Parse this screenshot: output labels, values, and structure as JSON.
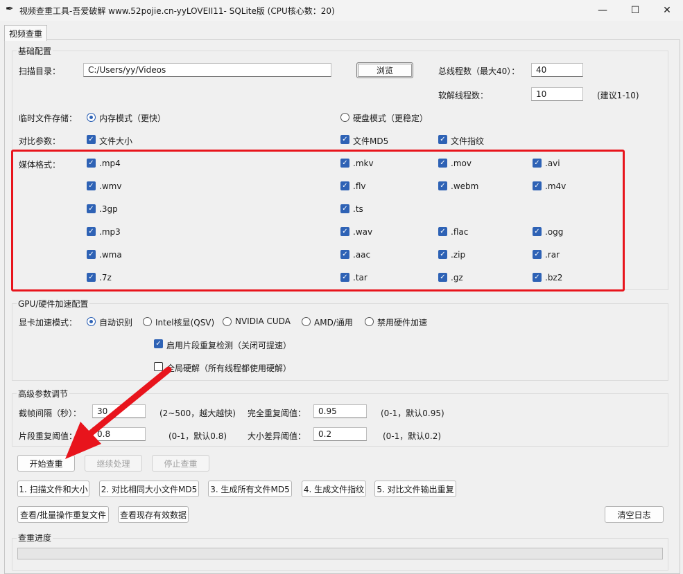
{
  "window": {
    "title": "视频查重工具-吾爱破解 www.52pojie.cn-yyLOVEII11- SQLite版 (CPU核心数：20)",
    "controls": [
      "—",
      "☐",
      "✕"
    ]
  },
  "tab": "视频查重",
  "basic": {
    "title": "基础配置",
    "scan_label": "扫描目录：",
    "scan_value": "C:/Users/yy/Videos",
    "browse": "浏览",
    "threads_label": "总线程数（最大40）：",
    "threads_value": "40",
    "soft_label": "软解线程数：",
    "soft_value": "10",
    "soft_hint": "(建议1-10)",
    "temp_label": "临时文件存储：",
    "temp_memory": "内存模式（更快）",
    "temp_disk": "硬盘模式（更稳定）",
    "compare_label": "对比参数：",
    "cmp_size": "文件大小",
    "cmp_md5": "文件MD5",
    "cmp_fp": "文件指纹",
    "media_label": "媒体格式：",
    "formats": [
      [
        ".mp4",
        ".mkv",
        ".mov",
        ".avi"
      ],
      [
        ".wmv",
        ".flv",
        ".webm",
        ".m4v"
      ],
      [
        ".3gp",
        ".ts",
        "",
        ""
      ],
      [
        ".mp3",
        ".wav",
        ".flac",
        ".ogg"
      ],
      [
        ".wma",
        ".aac",
        ".zip",
        ".rar"
      ],
      [
        ".7z",
        ".tar",
        ".gz",
        ".bz2"
      ]
    ]
  },
  "gpu": {
    "title": "GPU/硬件加速配置",
    "mode_label": "显卡加速模式：",
    "modes": [
      "自动识别",
      "Intel核显(QSV)",
      "NVIDIA CUDA",
      "AMD/通用",
      "禁用硬件加速"
    ],
    "segment": "启用片段重复检测（关闭可提速）",
    "global_hw": "全局硬解（所有线程都使用硬解）"
  },
  "advanced": {
    "title": "高级参数调节",
    "frame_label": "截帧间隔（秒）：",
    "frame_value": "30",
    "frame_hint": "(2~500，越大越快)",
    "full_label": "完全重复阈值：",
    "full_value": "0.95",
    "full_hint": "(0-1，默认0.95)",
    "seg_label": "片段重复阈值：",
    "seg_value": "0.8",
    "seg_hint": "(0-1，默认0.8)",
    "size_label": "大小差异阈值：",
    "size_value": "0.2",
    "size_hint": "(0-1，默认0.2)"
  },
  "actions": {
    "start": "开始查重",
    "continue": "继续处理",
    "stop": "停止查重",
    "step1": "1. 扫描文件和大小",
    "step2": "2. 对比相同大小文件MD5",
    "step3": "3. 生成所有文件MD5",
    "step4": "4. 生成文件指纹",
    "step5": "5. 对比文件输出重复",
    "view_dup": "查看/批量操作重复文件",
    "view_valid": "查看现存有效数据",
    "clear_log": "清空日志"
  },
  "progress": {
    "title": "查重进度",
    "value": 0
  },
  "colors": {
    "highlight": "#e8141c",
    "arrow": "#e8141c",
    "check": "#2e62b5"
  }
}
